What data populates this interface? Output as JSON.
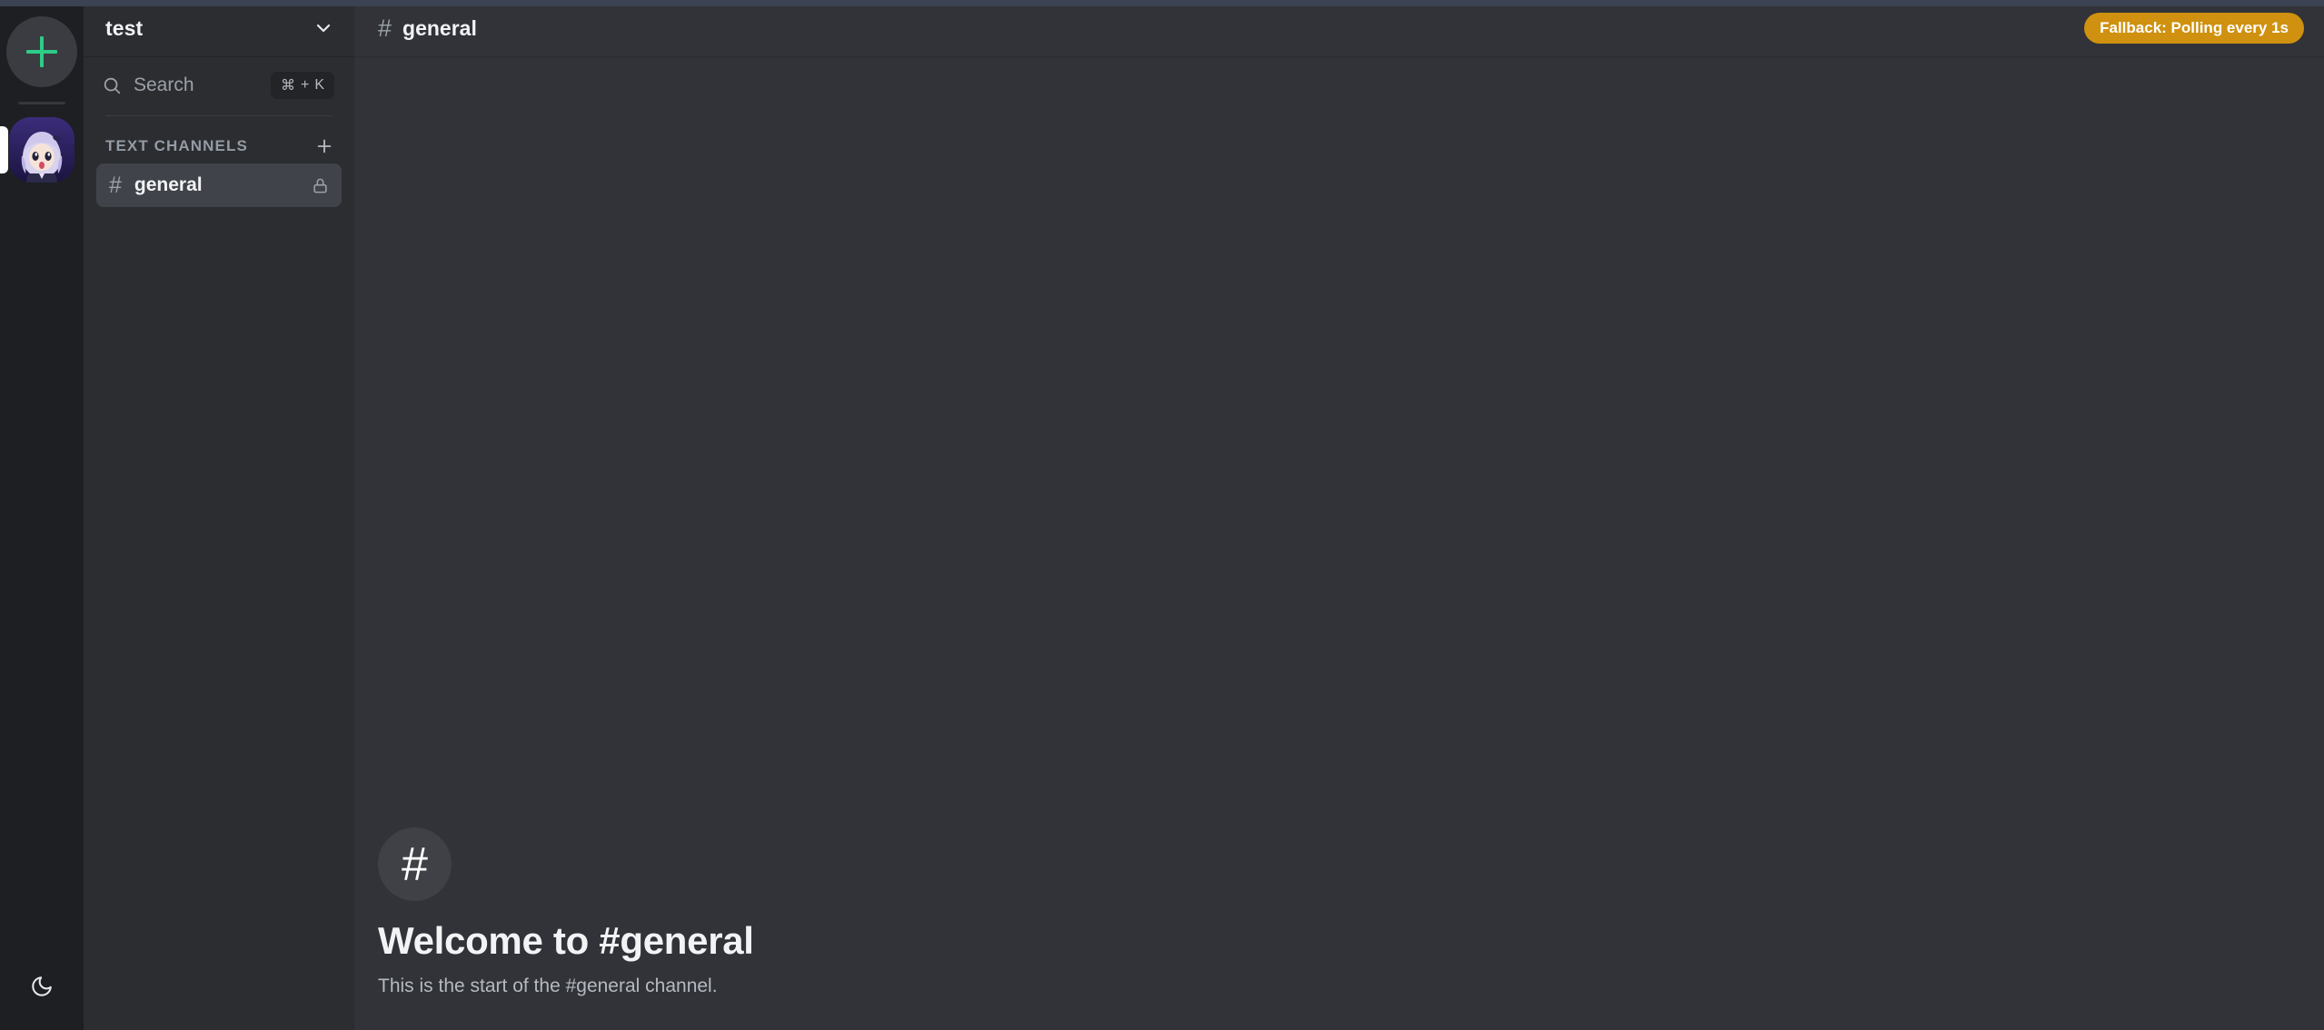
{
  "window": {
    "top_accent_color": "#3b4252",
    "rail_bg": "#1e1f22",
    "sidebar_bg": "#2b2d31",
    "main_bg": "#313338",
    "accent_green": "#2ecc87",
    "badge_amber": "#cf910f"
  },
  "server_rail": {
    "add_server_label": "+",
    "add_server_icon": "plus-icon",
    "divider_icon": "rail-divider",
    "servers": [
      {
        "name": "test",
        "avatar_icon": "anime-character-avatar",
        "active": true
      }
    ],
    "theme_toggle_icon": "moon-icon",
    "theme_toggle_label": "Toggle dark mode"
  },
  "sidebar": {
    "server_name": "test",
    "server_menu_icon": "chevron-down-icon",
    "search": {
      "icon": "search-icon",
      "placeholder": "Search",
      "value": "",
      "shortcut_modifier": "⌘",
      "shortcut_plus": "+",
      "shortcut_key": "K"
    },
    "group": {
      "title": "TEXT CHANNELS",
      "add_channel_icon": "plus-icon",
      "add_channel_label": "+"
    },
    "channels": [
      {
        "hash": "#",
        "name": "general",
        "active": true,
        "private": true,
        "lock_icon": "lock-icon"
      }
    ]
  },
  "channel_header": {
    "hash": "#",
    "title": "general",
    "status_badge": "Fallback: Polling every 1s"
  },
  "main": {
    "welcome": {
      "icon_hash": "#",
      "title": "Welcome to #general",
      "subtitle": "This is the start of the #general channel."
    }
  }
}
